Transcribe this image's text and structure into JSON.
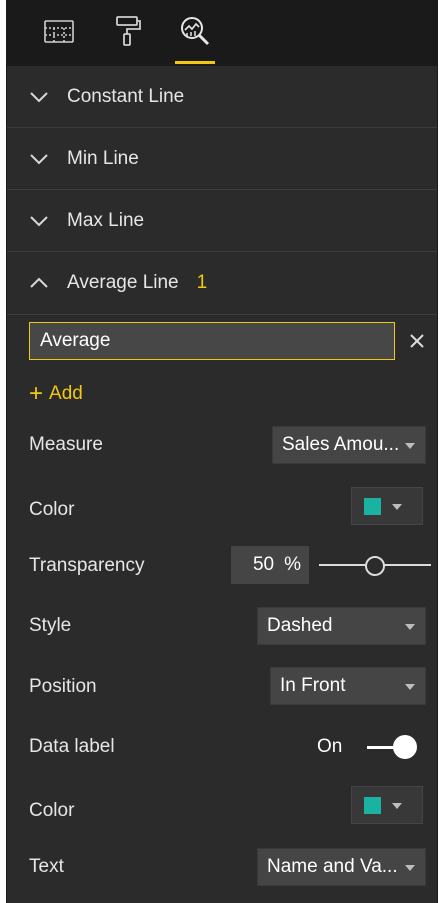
{
  "tabs": [
    {
      "name": "fields",
      "icon": "fields-grid-icon",
      "active": false
    },
    {
      "name": "format",
      "icon": "paint-roller-icon",
      "active": false
    },
    {
      "name": "analytics",
      "icon": "analytics-magnifier-icon",
      "active": true
    }
  ],
  "sections": {
    "constant_line": "Constant Line",
    "min_line": "Min Line",
    "max_line": "Max Line",
    "average_line": "Average Line",
    "average_line_count": "1"
  },
  "average": {
    "line_name": "Average",
    "add_label": "Add",
    "measure": {
      "label": "Measure",
      "value": "Sales Amou..."
    },
    "color": {
      "label": "Color",
      "value": "#1ab2a0"
    },
    "transparency": {
      "label": "Transparency",
      "value": "50",
      "unit": "%",
      "slider_fraction": 0.5
    },
    "style": {
      "label": "Style",
      "value": "Dashed"
    },
    "position": {
      "label": "Position",
      "value": "In Front"
    },
    "data_label": {
      "label": "Data label",
      "state": "On"
    },
    "label_color": {
      "label": "Color",
      "value": "#1ab2a0"
    },
    "text": {
      "label": "Text",
      "value": "Name and Va..."
    }
  },
  "colors": {
    "accent": "#f2c811",
    "panel_bg": "#2b2b2b",
    "topbar_bg": "#1a1a1a"
  }
}
